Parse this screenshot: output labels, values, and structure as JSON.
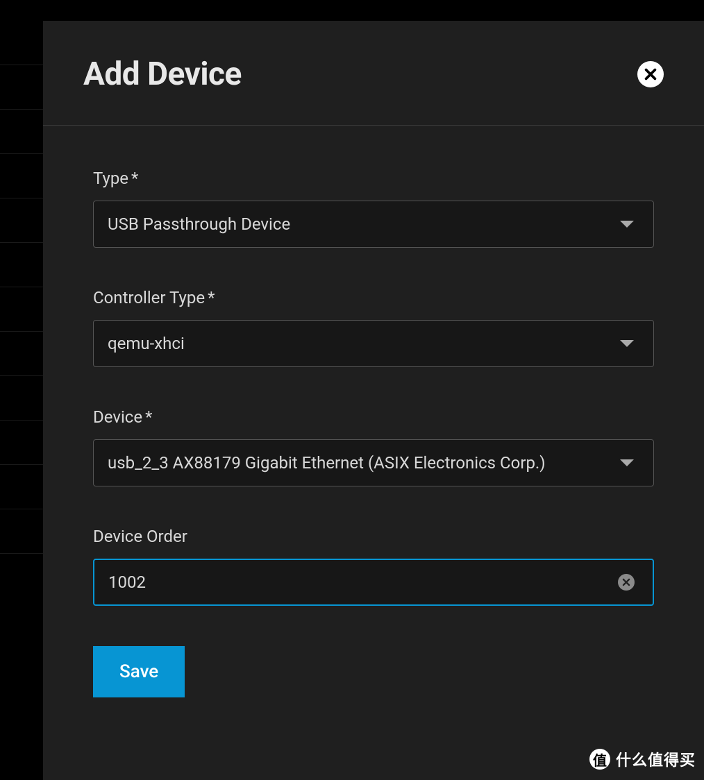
{
  "modal": {
    "title": "Add Device",
    "fields": {
      "type": {
        "label": "Type",
        "required": true,
        "value": "USB Passthrough Device"
      },
      "controllerType": {
        "label": "Controller Type",
        "required": true,
        "value": "qemu-xhci"
      },
      "device": {
        "label": "Device",
        "required": true,
        "value": "usb_2_3 AX88179 Gigabit Ethernet (ASIX Electronics Corp.)"
      },
      "deviceOrder": {
        "label": "Device Order",
        "required": false,
        "value": "1002"
      }
    },
    "saveButton": "Save"
  },
  "watermark": {
    "iconChar": "值",
    "text": "什么值得买"
  },
  "requiredMark": "*"
}
